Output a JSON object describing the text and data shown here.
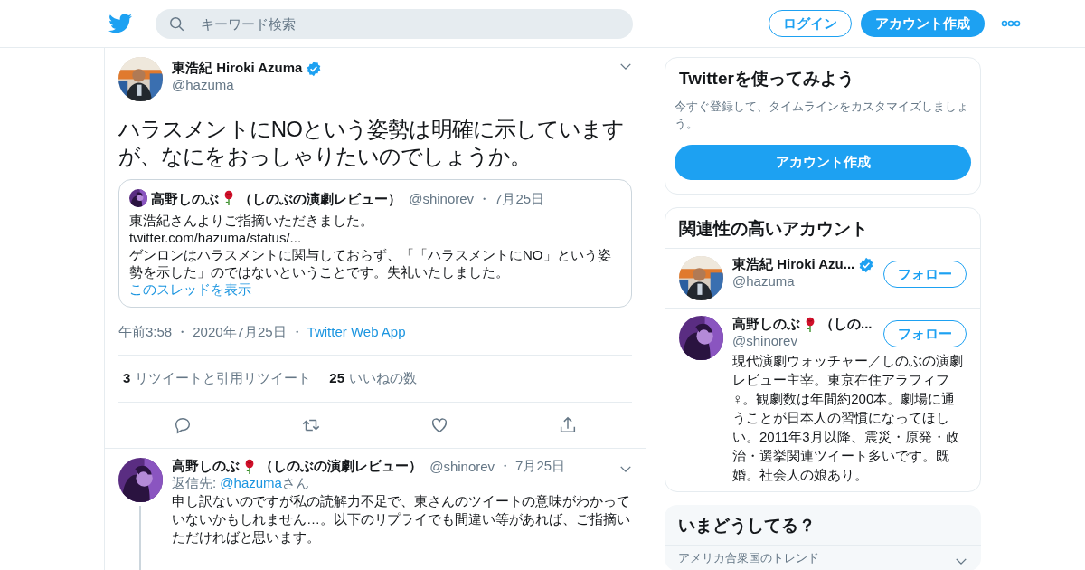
{
  "header": {
    "search": {
      "placeholder": "キーワード検索"
    },
    "login": "ログイン",
    "signup": "アカウント作成"
  },
  "main_tweet": {
    "name": "東浩紀 Hiroki Azuma",
    "verified": true,
    "handle": "@hazuma",
    "text": "ハラスメントにNOという姿勢は明確に示していますが、なにをおっしゃりたいのでしょうか。",
    "quote": {
      "name": "高野しのぶ",
      "name_suffix": "（しのぶの演劇レビュー）",
      "handle": "@shinorev",
      "separator": "・",
      "date": "7月25日",
      "lines": [
        "東浩紀さんよりご指摘いただきました。",
        "twitter.com/hazuma/status/...",
        "ゲンロンはハラスメントに関与しておらず、「「ハラスメントにNO」という姿勢を示した」のではないということです。失礼いたしました。"
      ],
      "show_thread": "このスレッドを表示"
    },
    "meta": {
      "time": "午前3:58",
      "separator_1": "・",
      "date": "2020年7月25日",
      "separator_2": "・",
      "source": "Twitter Web App"
    },
    "stats": [
      {
        "count": "3",
        "label": "リツイートと引用リツイート"
      },
      {
        "count": "25",
        "label": "いいねの数"
      }
    ]
  },
  "reply": {
    "name": "高野しのぶ",
    "name_suffix": "（しのぶの演劇レビュー）",
    "handle": "@shinorev",
    "separator": "・",
    "date": "7月25日",
    "reply_to_label": "返信先:",
    "reply_to": "@hazuma",
    "reply_to_suffix": "さん",
    "paragraphs": [
      "申し訳ないのですが私の読解力不足で、東さんのツイートの意味がわかっていないかもしれません…。以下のリプライでも間違い等があれば、ご指摘いただければと思います。"
    ]
  },
  "sidebar": {
    "signup_card": {
      "title": "Twitterを使ってみよう",
      "subtitle": "今すぐ登録して、タイムラインをカスタマイズしましょう。",
      "button": "アカウント作成"
    },
    "related": {
      "title": "関連性の高いアカウント",
      "accounts": [
        {
          "name": "東浩紀 Hiroki Azu...",
          "verified": true,
          "handle": "@hazuma",
          "follow": "フォロー"
        },
        {
          "name": "高野しのぶ",
          "name_suffix": "（しの...",
          "verified": false,
          "handle": "@shinorev",
          "follow": "フォロー",
          "bio": "現代演劇ウォッチャー／しのぶの演劇レビュー主宰。東京在住アラフィフ♀。観劇数は年間約200本。劇場に通うことが日本人の習慣になってほしい。2011年3月以降、震災・原発・政治・選挙関連ツイート多いです。既婚。社会人の娘あり。"
        }
      ]
    },
    "trends": {
      "title": "いまどうしてる？",
      "subtitle": "アメリカ合衆国のトレンド"
    }
  }
}
